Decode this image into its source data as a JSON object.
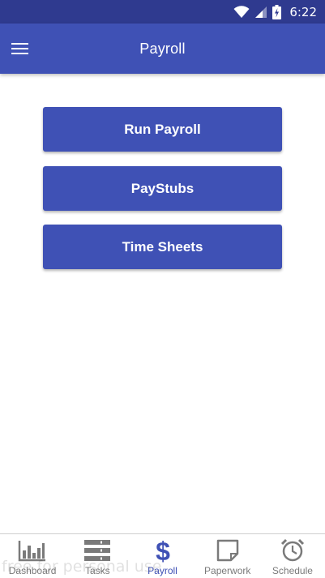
{
  "status_bar": {
    "time": "6:22",
    "icons": [
      "wifi-icon",
      "cell-signal-icon",
      "battery-charging-icon"
    ]
  },
  "app_bar": {
    "title": "Payroll",
    "menu_icon": "hamburger-menu-icon"
  },
  "actions": [
    {
      "label": "Run Payroll"
    },
    {
      "label": "PayStubs"
    },
    {
      "label": "Time Sheets"
    }
  ],
  "bottom_nav": {
    "items": [
      {
        "label": "Dashboard",
        "icon": "bar-chart-icon"
      },
      {
        "label": "Tasks",
        "icon": "list-icon"
      },
      {
        "label": "Payroll",
        "icon": "dollar-icon",
        "active": true
      },
      {
        "label": "Paperwork",
        "icon": "note-icon"
      },
      {
        "label": "Schedule",
        "icon": "alarm-clock-icon"
      }
    ]
  },
  "watermark": "free for personal use",
  "colors": {
    "primary": "#3f51b5",
    "status_bar": "#2f3a8f",
    "inactive": "#7a7a7a"
  }
}
